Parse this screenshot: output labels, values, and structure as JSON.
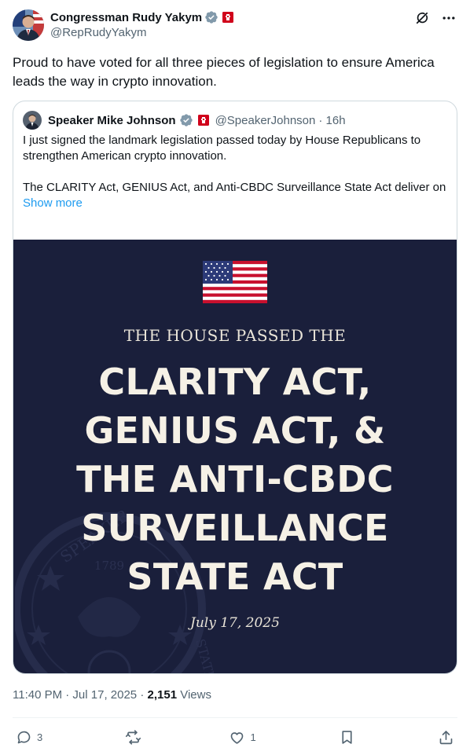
{
  "post": {
    "author_name": "Congressman Rudy Yakym",
    "author_handle": "@RepRudyYakym",
    "text": "Proud to have voted for all three pieces of legislation to ensure America leads the way in crypto innovation.",
    "timestamp": "11:40 PM · Jul 17, 2025",
    "views_count": "2,151",
    "views_label": "Views"
  },
  "quote": {
    "author_name": "Speaker Mike Johnson",
    "author_handle": "@SpeakerJohnson",
    "time": "· 16h",
    "paragraph1": "I just signed the landmark legislation passed today by House Republicans to strengthen American crypto innovation.",
    "paragraph2": "The CLARITY Act, GENIUS Act, and Anti-CBDC Surveillance State Act deliver on President Trump’s vision to make crypto a core pillar of the U.S. economy …",
    "show_more": "Show more"
  },
  "graphic": {
    "subtitle": "THE HOUSE PASSED THE",
    "title_lines": [
      "CLARITY ACT,",
      "GENIUS ACT, &",
      "THE ANTI-CBDC",
      "SURVEILLANCE",
      "STATE ACT"
    ],
    "date": "July 17, 2025",
    "seal_year": "1789"
  },
  "actions": {
    "replies": "3",
    "reposts": "",
    "likes": "1"
  },
  "icons": {
    "verified": "verified-badge-icon",
    "flag": "flag-badge-icon",
    "grok": "grok-icon",
    "more": "more-icon",
    "reply": "reply-icon",
    "repost": "repost-icon",
    "like": "like-icon",
    "bookmark": "bookmark-icon",
    "share": "share-icon"
  },
  "colors": {
    "link": "#1d9bf0",
    "verified": "#829aab",
    "graphic_bg": "#1a1f3b",
    "badge_red": "#d0021b"
  }
}
